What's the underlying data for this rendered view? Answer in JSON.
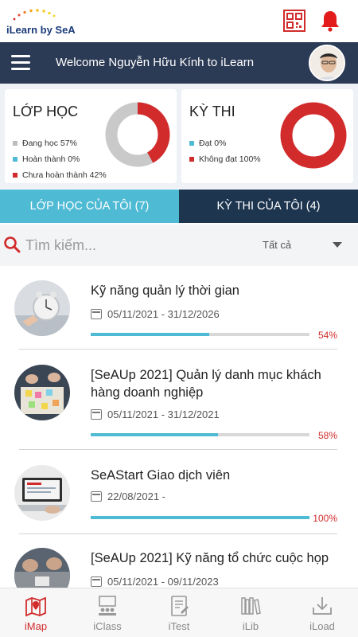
{
  "brand": {
    "logo_text": "iLearn by SeA"
  },
  "header": {
    "welcome": "Welcome Nguyễn Hữu Kính to iLearn"
  },
  "stats": {
    "classes": {
      "title": "LỚP HỌC",
      "legend": [
        {
          "label": "Đang học 57%",
          "color": "#bdbdbd",
          "value": 57
        },
        {
          "label": "Hoàn thành 0%",
          "color": "#4fbad4",
          "value": 0
        },
        {
          "label": "Chưa hoàn thành 42%",
          "color": "#d12b2b",
          "value": 42
        }
      ]
    },
    "exams": {
      "title": "KỲ THI",
      "legend": [
        {
          "label": "Đạt 0%",
          "color": "#4fbad4",
          "value": 0
        },
        {
          "label": "Không đạt 100%",
          "color": "#d12b2b",
          "value": 100
        }
      ]
    }
  },
  "tabs": [
    {
      "label": "LỚP HỌC CỦA TÔI (7)",
      "active": true
    },
    {
      "label": "KỲ THI CỦA TÔI (4)",
      "active": false
    }
  ],
  "search": {
    "placeholder": "Tìm kiếm...",
    "filter": "Tất cả"
  },
  "courses": [
    {
      "title": "Kỹ năng quản lý thời gian",
      "dates": "05/11/2021  - 31/12/2026",
      "progress": 54,
      "progress_label": "54%"
    },
    {
      "title": "[SeAUp 2021] Quản lý danh mục khách hàng doanh nghiệp",
      "dates": "05/11/2021  - 31/12/2021",
      "progress": 58,
      "progress_label": "58%"
    },
    {
      "title": "SeAStart Giao dịch viên",
      "dates": "22/08/2021  -",
      "progress": 100,
      "progress_label": "100%"
    },
    {
      "title": "[SeAUp 2021] Kỹ năng tổ chức cuộc họp",
      "dates": "05/11/2021  - 09/11/2023",
      "progress": null,
      "progress_label": ""
    }
  ],
  "nav": [
    {
      "label": "iMap",
      "icon": "map-icon",
      "active": true
    },
    {
      "label": "iClass",
      "icon": "classroom-icon",
      "active": false
    },
    {
      "label": "iTest",
      "icon": "test-icon",
      "active": false
    },
    {
      "label": "iLib",
      "icon": "library-icon",
      "active": false
    },
    {
      "label": "iLoad",
      "icon": "download-icon",
      "active": false
    }
  ],
  "colors": {
    "header": "#2b3a55",
    "accent": "#4fbad4",
    "danger": "#d12b2b",
    "tab_dark": "#1e3550"
  }
}
